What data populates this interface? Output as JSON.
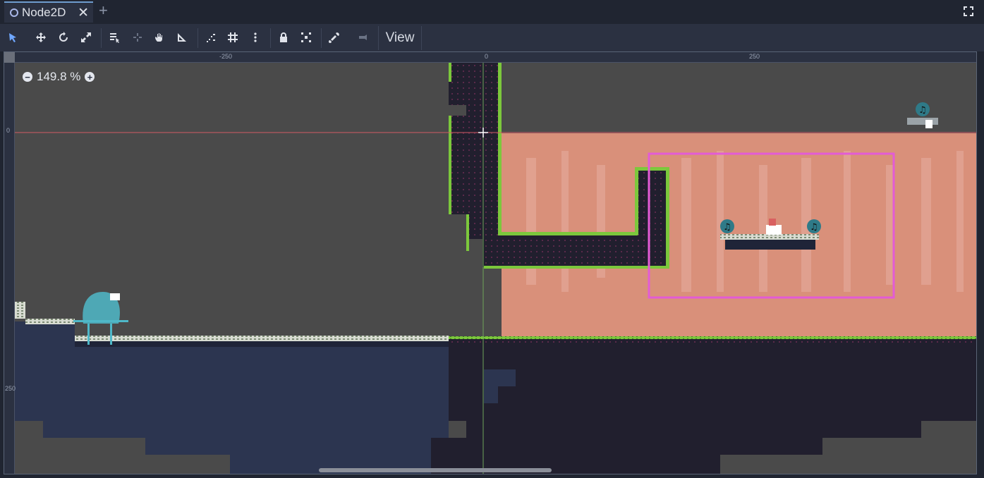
{
  "tab": {
    "title": "Node2D",
    "close": "✕",
    "add": "+"
  },
  "toolbar": {
    "view_label": "View",
    "icons": [
      "select-icon",
      "move-icon",
      "rotate-icon",
      "scale-icon",
      "list-select-icon",
      "pivot-icon",
      "pan-icon",
      "ruler-icon",
      "smart-snap-icon",
      "grid-snap-icon",
      "more-options-icon",
      "lock-icon",
      "group-icon",
      "skeleton-icon",
      "camera-override-icon"
    ]
  },
  "zoom": {
    "minus": "−",
    "value": "149.8 %",
    "plus": "+"
  },
  "rulers": {
    "top_labels": [
      "-250",
      "0",
      "250"
    ],
    "left_labels": [
      "0",
      "250"
    ]
  },
  "colors": {
    "background": "#4a4a4a",
    "sky_pink": "#d9907a",
    "water_blue": "#2c3550",
    "dark_earth": "#211f2e",
    "grass_green": "#7cc83c",
    "selection_pink": "#e35bd6",
    "origin_red": "#d35a64",
    "origin_green": "#6fa45a"
  }
}
